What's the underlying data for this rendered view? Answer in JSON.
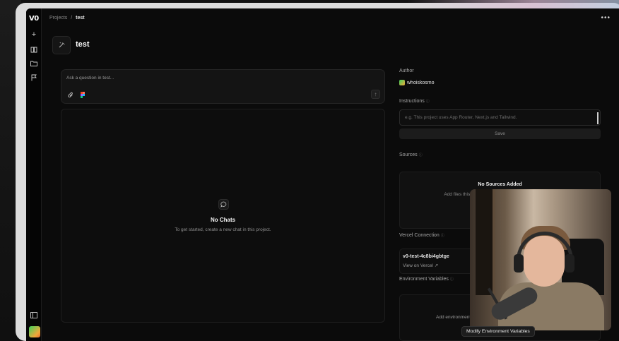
{
  "app": {
    "logo": "V0",
    "rail_icons": [
      "plus-icon",
      "book-icon",
      "folder-icon",
      "flag-icon",
      "sidebar-toggle-icon"
    ]
  },
  "breadcrumb": {
    "projects": "Projects",
    "separator": "/",
    "current": "test"
  },
  "header": {
    "project_title": "test",
    "menu_icon": "more-horizontal-icon"
  },
  "ask": {
    "placeholder": "Ask a question in test...",
    "attach_icon": "paperclip-icon",
    "figma_icon": "figma-icon",
    "send_icon": "arrow-up-icon"
  },
  "chats": {
    "empty_title": "No Chats",
    "empty_subtitle": "To get started, create a new chat in this project."
  },
  "sidebar": {
    "author_label": "Author",
    "author_name": "whoiskosmo",
    "instructions_label": "Instructions",
    "instructions_placeholder": "e.g. This project uses App Router, Next.js and Tailwind.",
    "save_label": "Save",
    "sources_label": "Sources",
    "sources_empty_title": "No Sources Added",
    "sources_empty_subtitle": "Add files this project should reference when generating",
    "vercel_label": "Vercel Connection",
    "vercel_project": "v0-test-4c8bi4gbtge",
    "vercel_link": "View on Vercel",
    "env_label": "Environment Variables",
    "env_empty": "Add environment variables"
  },
  "tooltip": "Modify Environment Variables",
  "colors": {
    "background": "#0b0b0b",
    "panel": "#141414",
    "border": "#242424",
    "avatar_gradient_start": "#3fd15a",
    "avatar_gradient_end": "#f0a83a"
  }
}
